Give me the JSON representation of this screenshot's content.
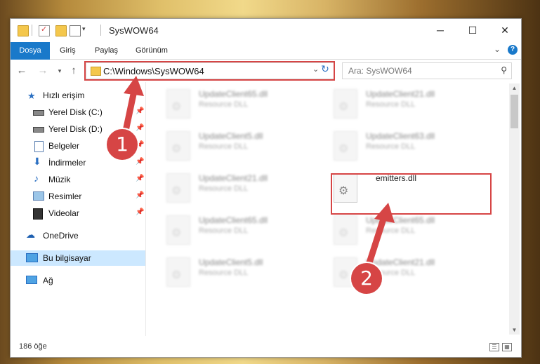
{
  "window": {
    "title": "SysWOW64",
    "controls": {
      "minimize": "─",
      "maximize": "☐",
      "close": "✕"
    }
  },
  "ribbon": {
    "tabs": [
      "Dosya",
      "Giriş",
      "Paylaş",
      "Görünüm"
    ],
    "collapse": "⌄",
    "help": "?"
  },
  "address": {
    "path": "C:\\Windows\\SysWOW64",
    "search_placeholder": "Ara: SysWOW64"
  },
  "nav": {
    "items": [
      {
        "label": "Hızlı erişim",
        "icon": "star-icon",
        "pinned": false
      },
      {
        "label": "Yerel Disk (C:)",
        "icon": "drive-icon",
        "pinned": true
      },
      {
        "label": "Yerel Disk (D:)",
        "icon": "drive-icon",
        "pinned": true
      },
      {
        "label": "Belgeler",
        "icon": "documents-icon",
        "pinned": true
      },
      {
        "label": "İndirmeler",
        "icon": "download-icon",
        "pinned": true
      },
      {
        "label": "Müzik",
        "icon": "music-icon",
        "pinned": true
      },
      {
        "label": "Resimler",
        "icon": "pictures-icon",
        "pinned": true
      },
      {
        "label": "Videolar",
        "icon": "videos-icon",
        "pinned": true
      },
      {
        "label": "OneDrive",
        "icon": "cloud-icon",
        "pinned": false
      },
      {
        "label": "Bu bilgisayar",
        "icon": "computer-icon",
        "pinned": false
      },
      {
        "label": "Ağ",
        "icon": "network-icon",
        "pinned": false
      }
    ]
  },
  "files": [
    {
      "name": "UpdateClient65.dll",
      "type": "Resource DLL",
      "blurred": true
    },
    {
      "name": "UpdateClient21.dll",
      "type": "Resource DLL",
      "blurred": true
    },
    {
      "name": "UpdateClient5.dll",
      "type": "Resource DLL",
      "blurred": true
    },
    {
      "name": "UpdateClient63.dll",
      "type": "Resource DLL",
      "blurred": true
    },
    {
      "name": "UpdateClient21.dll",
      "type": "Resource DLL",
      "blurred": true
    },
    {
      "name": "emitters.dll",
      "type": "",
      "blurred": false
    },
    {
      "name": "UpdateClient65.dll",
      "type": "Resource DLL",
      "blurred": true
    },
    {
      "name": "UpdateClient65.dll",
      "type": "Resource DLL",
      "blurred": true
    },
    {
      "name": "UpdateClient5.dll",
      "type": "Resource DLL",
      "blurred": true
    },
    {
      "name": "UpdateClient21.dll",
      "type": "Resource DLL",
      "blurred": true
    }
  ],
  "status": {
    "count": "186 öğe"
  },
  "annotations": {
    "step1": "1",
    "step2": "2",
    "color": "#d64545"
  }
}
